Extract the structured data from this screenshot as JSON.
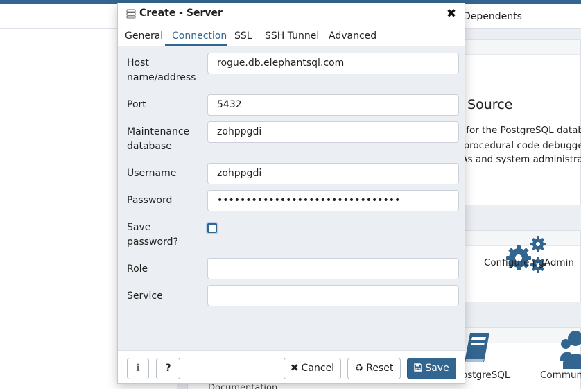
{
  "background": {
    "tab_dependents": "Dependents",
    "welcome_heading": "n Source",
    "welcome_lines": [
      "ol for the PostgreSQL databa",
      "a procedural code debugge",
      "BAs and system administra"
    ],
    "configure_label": "Configure pgAdmin",
    "postgresql_label": "ostgreSQL",
    "community_label": "Communi",
    "documentation_label": "Documentation"
  },
  "dialog": {
    "title": "Create - Server",
    "close_symbol": "✖",
    "tabs": [
      {
        "label": "General",
        "active": false
      },
      {
        "label": "Connection",
        "active": true
      },
      {
        "label": "SSL",
        "active": false
      },
      {
        "label": "SSH Tunnel",
        "active": false
      },
      {
        "label": "Advanced",
        "active": false
      }
    ],
    "fields": {
      "host": {
        "label_line1": "Host",
        "label_line2": "name/address",
        "value": "rogue.db.elephantsql.com"
      },
      "port": {
        "label": "Port",
        "value": "5432"
      },
      "maintenance_db": {
        "label_line1": "Maintenance",
        "label_line2": "database",
        "value": "zohppgdi"
      },
      "username": {
        "label": "Username",
        "value": "zohppgdi"
      },
      "password": {
        "label": "Password",
        "value": "••••••••••••••••••••••••••••••••"
      },
      "save_password": {
        "label_line1": "Save",
        "label_line2": "password?",
        "checked": false
      },
      "role": {
        "label": "Role",
        "value": ""
      },
      "service": {
        "label": "Service",
        "value": ""
      }
    },
    "footer": {
      "info_symbol": "i",
      "help_symbol": "?",
      "cancel_label": "Cancel",
      "reset_label": "Reset",
      "save_label": "Save"
    }
  },
  "colors": {
    "accent": "#326690",
    "dialog_bg": "#ebeef3",
    "field_border": "#ccd1d9"
  },
  "icons": {
    "title": "server-icon",
    "close": "close-icon",
    "cancel": "times-icon",
    "reset": "recycle-icon",
    "save": "floppy-disk-icon",
    "configure": "gears-icon",
    "docs": "book-icon",
    "community": "users-icon"
  }
}
